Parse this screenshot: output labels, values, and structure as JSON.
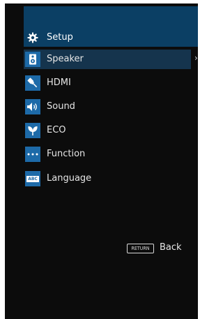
{
  "header": {
    "title": "Setup",
    "icon": "gear-icon"
  },
  "menu": {
    "items": [
      {
        "label": "Speaker",
        "icon": "speaker-icon"
      },
      {
        "label": "HDMI",
        "icon": "hdmi-cable-icon"
      },
      {
        "label": "Sound",
        "icon": "sound-icon"
      },
      {
        "label": "ECO",
        "icon": "leaf-icon"
      },
      {
        "label": "Function",
        "icon": "ellipsis-icon"
      },
      {
        "label": "Language",
        "icon": "abc-icon",
        "icon_text": "ABC"
      }
    ],
    "selected_label": "Speaker"
  },
  "footer": {
    "return_key": "RETURN",
    "return_label": "Back"
  },
  "colors": {
    "header_bg": "#0b3f64",
    "icon_bg": "#1d6aa8",
    "selected_bg": "#15344d",
    "screen_bg": "#0c0c0c"
  }
}
